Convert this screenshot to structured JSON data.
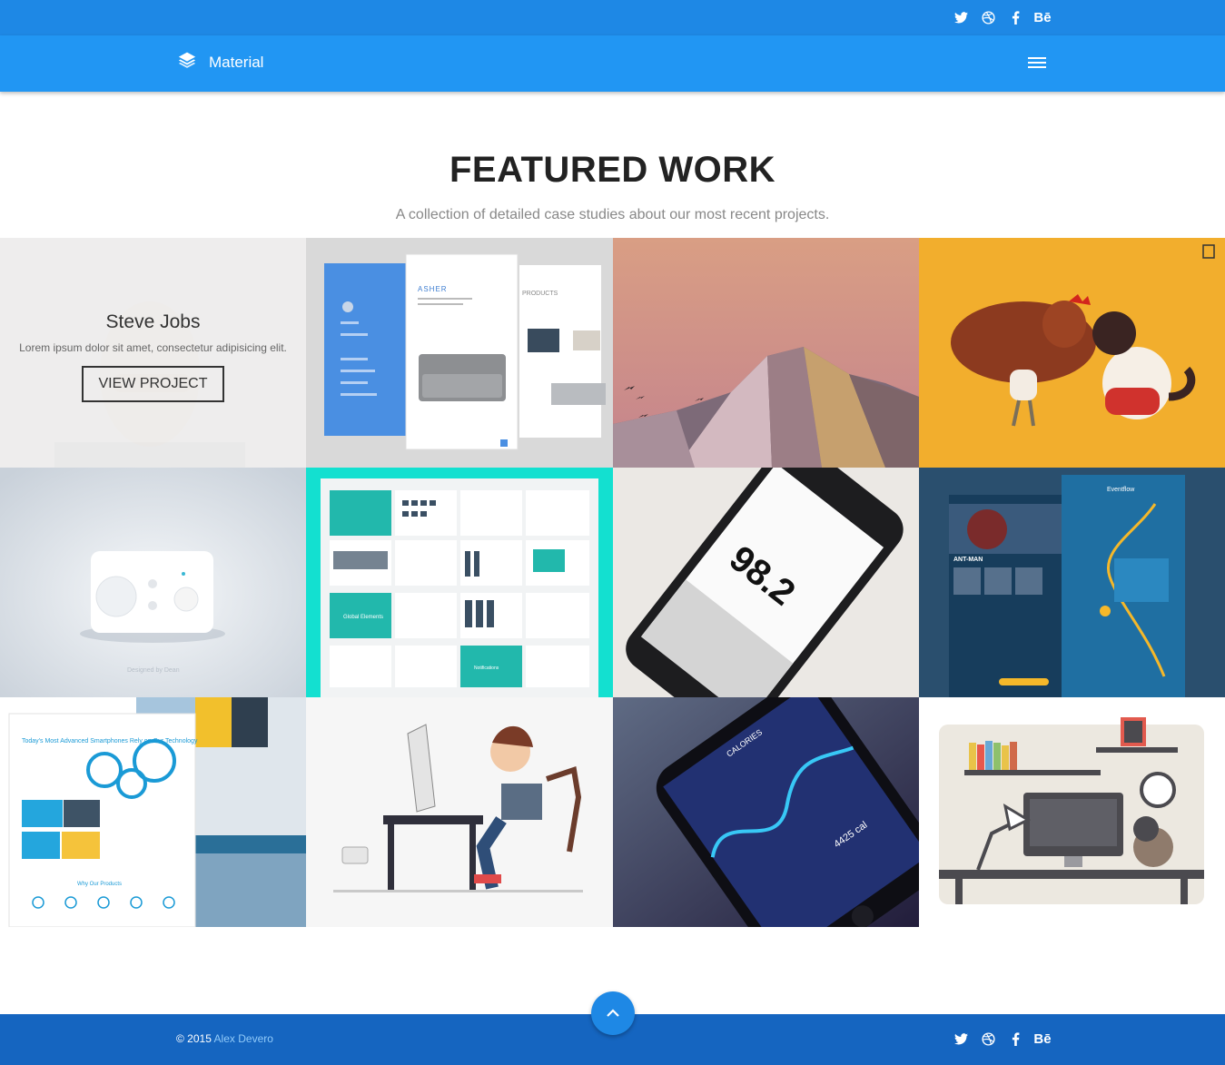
{
  "social_links": [
    "twitter-icon",
    "dribbble-icon",
    "facebook-icon",
    "behance-icon"
  ],
  "behance_label": "Bē",
  "brand": {
    "name": "Material"
  },
  "featured": {
    "title_light": "FEATURED ",
    "title_bold": "WORK",
    "subtitle": "A collection of detailed case studies about our most recent projects."
  },
  "portfolio": [
    {
      "name": "Steve Jobs",
      "description": "Lorem ipsum dolor sit amet, consectetur adipisicing elit.",
      "cta": "VIEW PROJECT"
    },
    {
      "label": "ASHER",
      "label2": "PRODUCTS"
    },
    {},
    {},
    {
      "caption": "Designed by Dean"
    },
    {
      "label": "Global Elements",
      "label2": "Notifications"
    },
    {
      "value": "98.2"
    },
    {
      "label": "Eventflow",
      "label2": "ANT-MAN"
    },
    {
      "label": "Today's Most Advanced Smartphones Rely on Our Technology",
      "label2": "Why Our Products"
    },
    {},
    {
      "label": "CALORIES",
      "label2": "4425 cal"
    },
    {}
  ],
  "footer": {
    "year": "© 2015 ",
    "author": "Alex Devero"
  },
  "colors": {
    "topbar": "#1e88e5",
    "navbar": "#2196f3",
    "footer": "#1565c0"
  }
}
